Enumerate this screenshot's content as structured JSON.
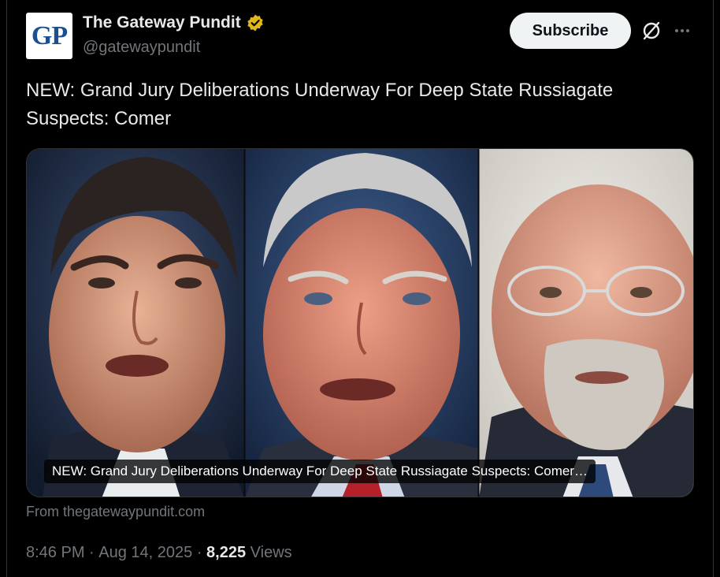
{
  "account": {
    "avatar_text": "GP",
    "name": "The Gateway Pundit",
    "handle": "@gatewaypundit",
    "verified_icon": "gold-verified-badge"
  },
  "actions": {
    "subscribe_label": "Subscribe",
    "grok_icon": "grok-icon",
    "more_icon": "more-icon"
  },
  "tweet": {
    "text": "NEW: Grand Jury Deliberations Underway For Deep State Russiagate Suspects: Comer",
    "link_card": {
      "title": "NEW: Grand Jury Deliberations Underway For Deep State Russiagate Suspects: Comer…",
      "source": "From thegatewaypundit.com"
    }
  },
  "meta": {
    "time": "8:46 PM",
    "separator": " · ",
    "date": "Aug 14, 2025",
    "views_count": "8,225",
    "views_label": " Views"
  },
  "colors": {
    "background": "#000000",
    "text_primary": "#e7e9ea",
    "text_secondary": "#71767b",
    "verified_gold": "#e2b719",
    "button_bg": "#eff3f4"
  }
}
